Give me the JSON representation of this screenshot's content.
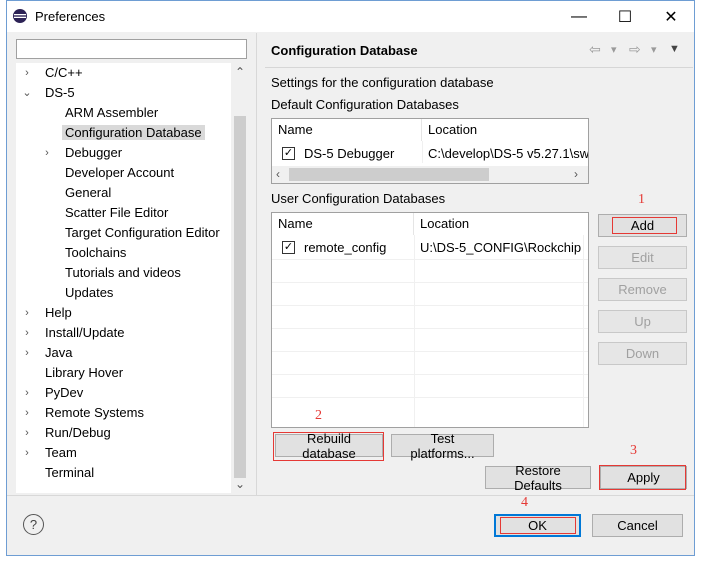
{
  "window": {
    "title": "Preferences",
    "controls": {
      "minimize": "—",
      "maximize": "☐",
      "close": "✕"
    }
  },
  "filter": {
    "value": "",
    "placeholder": ""
  },
  "tree": [
    {
      "label": "C/C++",
      "twisty": "›"
    },
    {
      "label": "DS-5",
      "twisty": "⌄"
    },
    {
      "label": "ARM Assembler",
      "twisty": ""
    },
    {
      "label": "Configuration Database",
      "twisty": ""
    },
    {
      "label": "Debugger",
      "twisty": "›"
    },
    {
      "label": "Developer Account",
      "twisty": ""
    },
    {
      "label": "General",
      "twisty": ""
    },
    {
      "label": "Scatter File Editor",
      "twisty": ""
    },
    {
      "label": "Target Configuration Editor",
      "twisty": ""
    },
    {
      "label": "Toolchains",
      "twisty": ""
    },
    {
      "label": "Tutorials and videos",
      "twisty": ""
    },
    {
      "label": "Updates",
      "twisty": ""
    },
    {
      "label": "Help",
      "twisty": "›"
    },
    {
      "label": "Install/Update",
      "twisty": "›"
    },
    {
      "label": "Java",
      "twisty": "›"
    },
    {
      "label": "Library Hover",
      "twisty": ""
    },
    {
      "label": "PyDev",
      "twisty": "›"
    },
    {
      "label": "Remote Systems",
      "twisty": "›"
    },
    {
      "label": "Run/Debug",
      "twisty": "›"
    },
    {
      "label": "Team",
      "twisty": "›"
    },
    {
      "label": "Terminal",
      "twisty": ""
    }
  ],
  "page": {
    "title": "Configuration Database",
    "description": "Settings for the configuration database",
    "default_section": "Default Configuration Databases",
    "user_section": "User Configuration Databases",
    "col_name": "Name",
    "col_location": "Location",
    "default_rows": [
      {
        "name": "DS-5 Debugger",
        "location": "C:\\develop\\DS-5 v5.27.1\\sw",
        "checked": "✓"
      }
    ],
    "user_rows": [
      {
        "name": "remote_config",
        "location": "U:\\DS-5_CONFIG\\Rockchip",
        "checked": "✓"
      }
    ]
  },
  "buttons": {
    "add": "Add",
    "edit": "Edit",
    "remove": "Remove",
    "up": "Up",
    "down": "Down",
    "rebuild": "Rebuild database",
    "test": "Test platforms...",
    "restore": "Restore Defaults",
    "apply": "Apply",
    "ok": "OK",
    "cancel": "Cancel"
  },
  "annotations": {
    "n1": "1",
    "n2": "2",
    "n3": "3",
    "n4": "4"
  },
  "icons": {
    "back": "⇦",
    "forward": "⇨",
    "dropdown": "▾",
    "menu": "▼",
    "scroll_up": "⌃",
    "scroll_down": "⌄",
    "scroll_left": "‹",
    "scroll_right": "›",
    "help": "?"
  },
  "colors": {
    "annotation": "#e53935",
    "ok_focus": "#0078d7"
  }
}
